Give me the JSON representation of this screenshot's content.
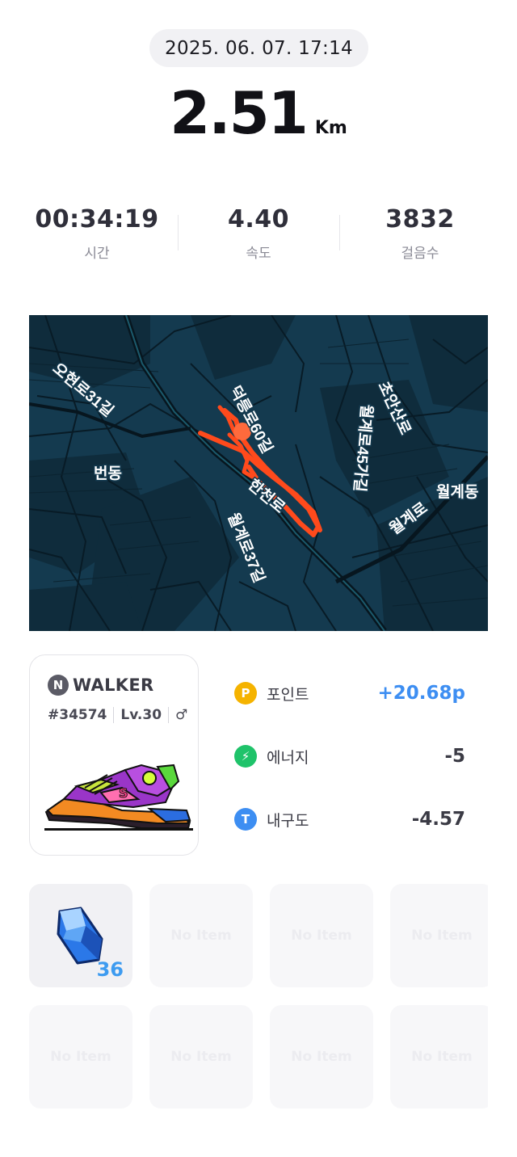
{
  "record": {
    "datetime": "2025. 06. 07. 17:14",
    "distance": "2.51",
    "distance_unit": "Km"
  },
  "stats": [
    {
      "value": "00:34:19",
      "label": "시간"
    },
    {
      "value": "4.40",
      "label": "속도"
    },
    {
      "value": "3832",
      "label": "걸음수"
    }
  ],
  "map": {
    "labels": [
      "오현로31길",
      "번동",
      "덕릉로60길",
      "한천로",
      "월계로37길",
      "월계로45가길",
      "초안산로",
      "월계동",
      "월계로"
    ],
    "route_color": "#ff4a1c",
    "background_color": "#143a4f"
  },
  "nft": {
    "brand_initial": "N",
    "brand": "WALKER",
    "id": "#34574",
    "level": "Lv.30",
    "gender_symbol": "♂",
    "shoe_badge": "S"
  },
  "rewards": [
    {
      "icon": "point-icon",
      "glyph": "P",
      "label": "포인트",
      "value": "+20.68p",
      "color": "#f5b300"
    },
    {
      "icon": "energy-icon",
      "glyph": "⚡",
      "label": "에너지",
      "value": "-5",
      "color": "#1fc36a"
    },
    {
      "icon": "durability-icon",
      "glyph": "T",
      "label": "내구도",
      "value": "-4.57",
      "color": "#3d8ef2"
    }
  ],
  "items": {
    "gem_count": "36",
    "empty_label": "No Item"
  }
}
